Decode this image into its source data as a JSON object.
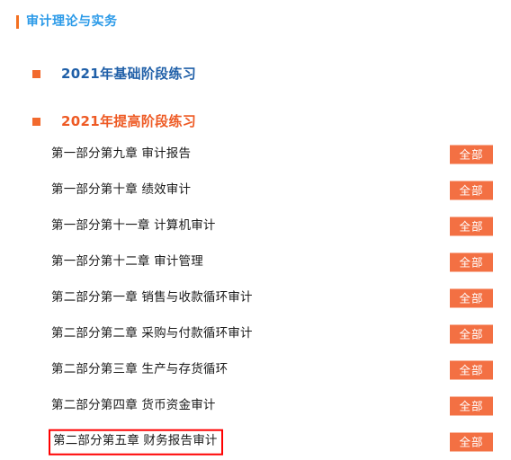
{
  "page": {
    "title": "审计理论与实务",
    "accent_color": "#f37021",
    "title_color": "#2b9ae8",
    "background": "#ffffff"
  },
  "sections": [
    {
      "label": "2021年基础阶段练习",
      "bullet_icon": "square-bullet-icon",
      "color": "#1f5fa8",
      "expanded": false,
      "chapters": []
    },
    {
      "label": "2021年提高阶段练习",
      "bullet_icon": "square-bullet-icon",
      "color": "#ee5a24",
      "expanded": true,
      "chapters": [
        {
          "title": "第一部分第九章  审计报告",
          "action_label": "全部",
          "highlighted": false
        },
        {
          "title": "第一部分第十章  绩效审计",
          "action_label": "全部",
          "highlighted": false
        },
        {
          "title": "第一部分第十一章  计算机审计",
          "action_label": "全部",
          "highlighted": false
        },
        {
          "title": "第一部分第十二章  审计管理",
          "action_label": "全部",
          "highlighted": false
        },
        {
          "title": "第二部分第一章  销售与收款循环审计",
          "action_label": "全部",
          "highlighted": false
        },
        {
          "title": "第二部分第二章  采购与付款循环审计",
          "action_label": "全部",
          "highlighted": false
        },
        {
          "title": "第二部分第三章  生产与存货循环",
          "action_label": "全部",
          "highlighted": false
        },
        {
          "title": "第二部分第四章  货币资金审计",
          "action_label": "全部",
          "highlighted": false
        },
        {
          "title": "第二部分第五章  财务报告审计",
          "action_label": "全部",
          "highlighted": true
        }
      ]
    }
  ],
  "annotation": {
    "highlight_color": "#ff0000",
    "target": "第二部分第五章  财务报告审计"
  },
  "button_color": "#f37043"
}
